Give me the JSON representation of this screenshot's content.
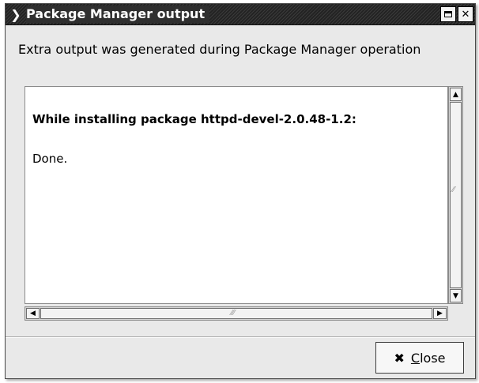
{
  "window": {
    "title": "Package Manager output",
    "menu_icon": "chevron-down-icon",
    "maximize_icon": "maximize-icon",
    "close_icon": "close-icon"
  },
  "dialog": {
    "message": "Extra output was generated during Package Manager operation",
    "output_lines": [
      "While installing package httpd-devel-2.0.48-1.2:",
      "Done."
    ]
  },
  "buttons": {
    "close_mnemonic": "C",
    "close_rest": "lose",
    "close_icon": "close-x-icon"
  },
  "scrollbars": {
    "up_icon": "arrow-up-icon",
    "down_icon": "arrow-down-icon",
    "left_icon": "arrow-left-icon",
    "right_icon": "arrow-right-icon"
  }
}
